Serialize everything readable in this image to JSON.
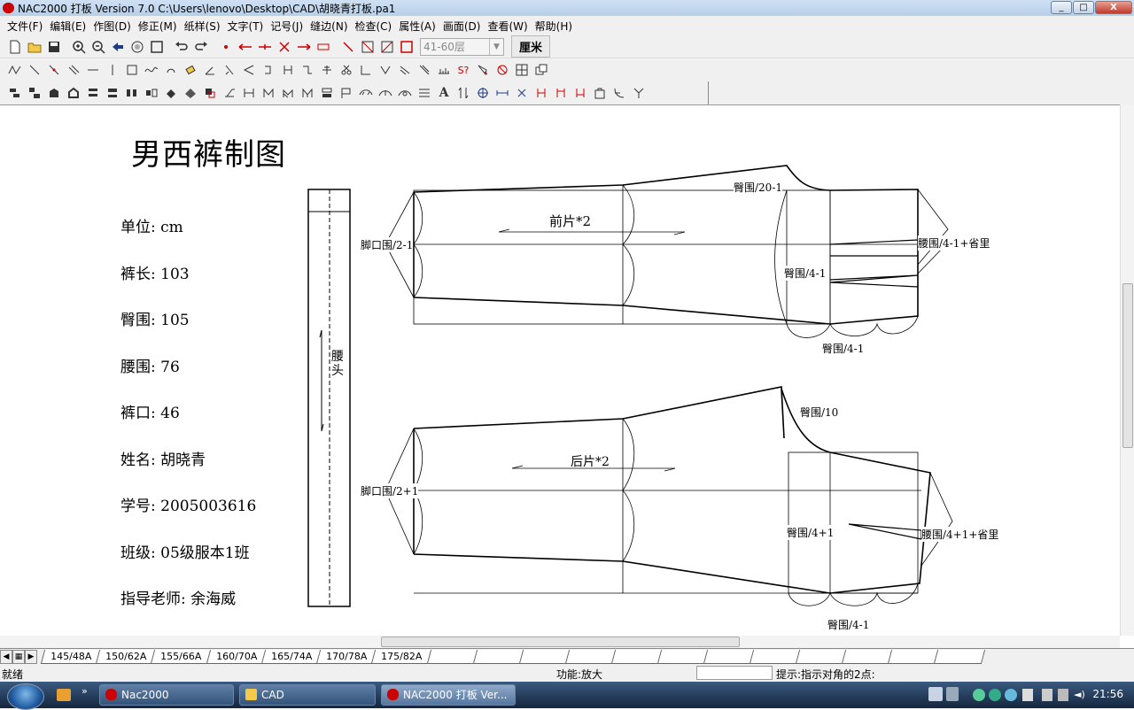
{
  "window": {
    "title": "NAC2000 打板 Version 7.0  C:\\Users\\lenovo\\Desktop\\CAD\\胡晓青打板.pa1",
    "controls": [
      "_",
      "□",
      "X"
    ]
  },
  "menu": [
    "文件(F)",
    "编辑(E)",
    "作图(D)",
    "修正(M)",
    "纸样(S)",
    "文字(T)",
    "记号(J)",
    "缝边(N)",
    "检查(C)",
    "属性(A)",
    "画面(D)",
    "查看(W)",
    "帮助(H)"
  ],
  "toolbar": {
    "layer_select": "41-60层",
    "unit_label": "厘米"
  },
  "drawing": {
    "title": "男西裤制图",
    "info": [
      "单位: cm",
      "裤长: 103",
      "臀围: 105",
      "腰围: 76",
      "裤口: 46",
      "姓名: 胡晓青",
      "学号: 2005003616",
      "班级: 05级服本1班",
      "指导老师: 余海威"
    ],
    "waistband_label": "腰头",
    "front": {
      "label": "前片*2",
      "hem": "脚口围/2-1",
      "hip_top": "臀围/20-1",
      "hip_mid": "臀围/4-1",
      "waist": "腰围/4-1+省里",
      "hip_bottom": "臀围/4-1"
    },
    "back": {
      "label": "后片*2",
      "hem": "脚口围/2+1",
      "crotch": "臀围/10",
      "hip_mid": "臀围/4+1",
      "waist": "腰围/4+1+省里",
      "hip_bottom": "臀围/4-1"
    }
  },
  "sheet_tabs": [
    "145/48A",
    "150/62A",
    "155/66A",
    "160/70A",
    "165/74A",
    "170/78A",
    "175/82A"
  ],
  "active_tab": "160/70A",
  "status": {
    "ready": "就绪",
    "function": "功能:放大",
    "hint": "提示:指示对角的2点:"
  },
  "taskbar": {
    "items": [
      "Nac2000",
      "CAD",
      "NAC2000 打板 Ver..."
    ],
    "clock": "21:56"
  }
}
